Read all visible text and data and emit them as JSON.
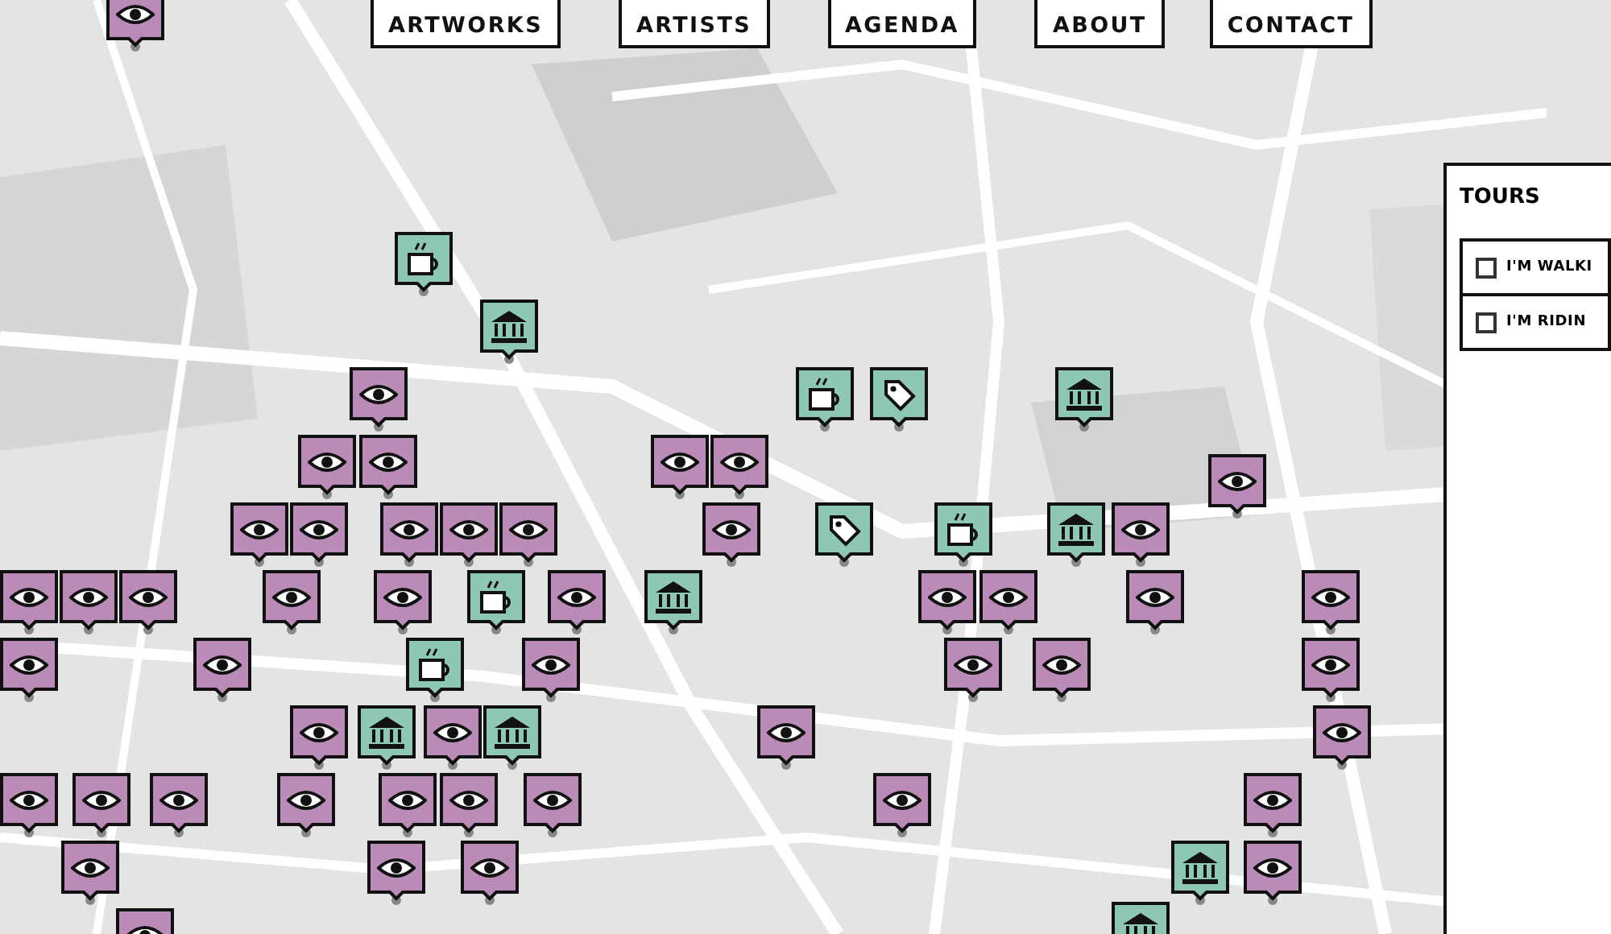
{
  "nav": [
    {
      "label": "ARTWORKS",
      "selected": false
    },
    {
      "label": "ARTISTS",
      "selected": false
    },
    {
      "label": "AGENDA",
      "selected": false
    },
    {
      "label": "ABOUT",
      "selected": false
    },
    {
      "label": "CONTACT",
      "selected": false
    }
  ],
  "map": {
    "kind": "picture",
    "markers": [
      {
        "kind": "artwork"
      },
      {
        "kind": "artwork"
      },
      {
        "kind": "artwork"
      },
      {
        "kind": "artwork"
      },
      {
        "kind": "artwork"
      },
      {
        "kind": "artwork"
      },
      {
        "kind": "artwork"
      },
      {
        "kind": "artwork"
      },
      {
        "kind": "artwork"
      },
      {
        "kind": "artwork"
      },
      {
        "kind": "artwork"
      },
      {
        "kind": "artwork"
      },
      {
        "kind": "artwork"
      },
      {
        "kind": "artwork"
      },
      {
        "kind": "artwork"
      },
      {
        "kind": "artwork"
      },
      {
        "kind": "artwork"
      },
      {
        "kind": "artwork"
      },
      {
        "kind": "artwork"
      },
      {
        "kind": "artwork"
      },
      {
        "kind": "artwork"
      },
      {
        "kind": "artwork"
      },
      {
        "kind": "artwork"
      },
      {
        "kind": "artwork"
      },
      {
        "kind": "artwork"
      },
      {
        "kind": "artwork"
      },
      {
        "kind": "artwork"
      },
      {
        "kind": "artwork"
      },
      {
        "kind": "artwork"
      },
      {
        "kind": "artwork"
      },
      {
        "kind": "artwork"
      },
      {
        "kind": "artwork"
      },
      {
        "kind": "artwork"
      },
      {
        "kind": "artwork"
      },
      {
        "kind": "artwork"
      },
      {
        "kind": "artwork"
      },
      {
        "kind": "artwork"
      },
      {
        "kind": "artwork"
      },
      {
        "kind": "artwork"
      },
      {
        "kind": "artwork"
      },
      {
        "kind": "artwork"
      },
      {
        "kind": "artwork"
      },
      {
        "kind": "artwork"
      },
      {
        "kind": "artwork"
      },
      {
        "kind": "artwork"
      },
      {
        "kind": "artwork"
      },
      {
        "kind": "artwork"
      },
      {
        "kind": "artwork"
      },
      {
        "kind": "museum"
      },
      {
        "kind": "museum"
      },
      {
        "kind": "museum"
      },
      {
        "kind": "museum"
      },
      {
        "kind": "museum"
      },
      {
        "kind": "museum"
      },
      {
        "kind": "museum"
      },
      {
        "kind": "museum"
      },
      {
        "kind": "cafe"
      },
      {
        "kind": "cafe"
      },
      {
        "kind": "cafe"
      },
      {
        "kind": "cafe"
      },
      {
        "kind": "cafe"
      },
      {
        "kind": "shop"
      },
      {
        "kind": "shop"
      }
    ]
  },
  "tours": {
    "title": "TOURS",
    "options": [
      {
        "label": "I'M WALKI",
        "checked": false
      },
      {
        "label": "I'M RIDIN",
        "checked": false
      }
    ]
  }
}
